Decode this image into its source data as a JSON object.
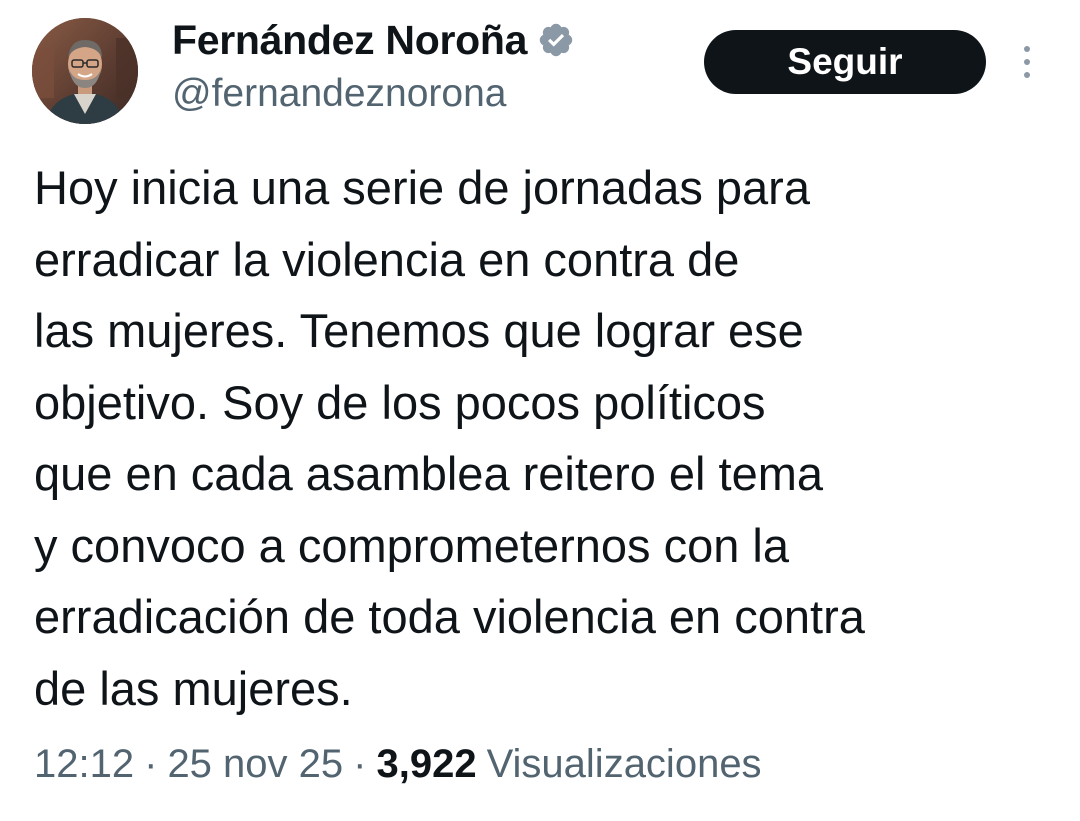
{
  "author": {
    "display_name": "Fernández Noroña",
    "handle": "@fernandeznorona",
    "verified": true
  },
  "actions": {
    "follow_label": "Seguir",
    "more_icon": "more-vertical-icon"
  },
  "tweet": {
    "lines": [
      "Hoy inicia una serie de jornadas para",
      "erradicar la violencia en contra de",
      "las mujeres. Tenemos que lograr ese",
      "objetivo. Soy de los pocos políticos",
      "que en cada asamblea reitero el tema",
      "y convoco a comprometernos con la",
      "erradicación de toda violencia en contra",
      "de las mujeres."
    ]
  },
  "meta": {
    "time": "12:12",
    "separator": "·",
    "date": "25 nov 25",
    "views_count": "3,922",
    "views_label": "Visualizaciones"
  },
  "colors": {
    "text_primary": "#0f1419",
    "text_secondary": "#536471",
    "button_bg": "#0f1419",
    "verified_badge": "#8b98a5"
  }
}
